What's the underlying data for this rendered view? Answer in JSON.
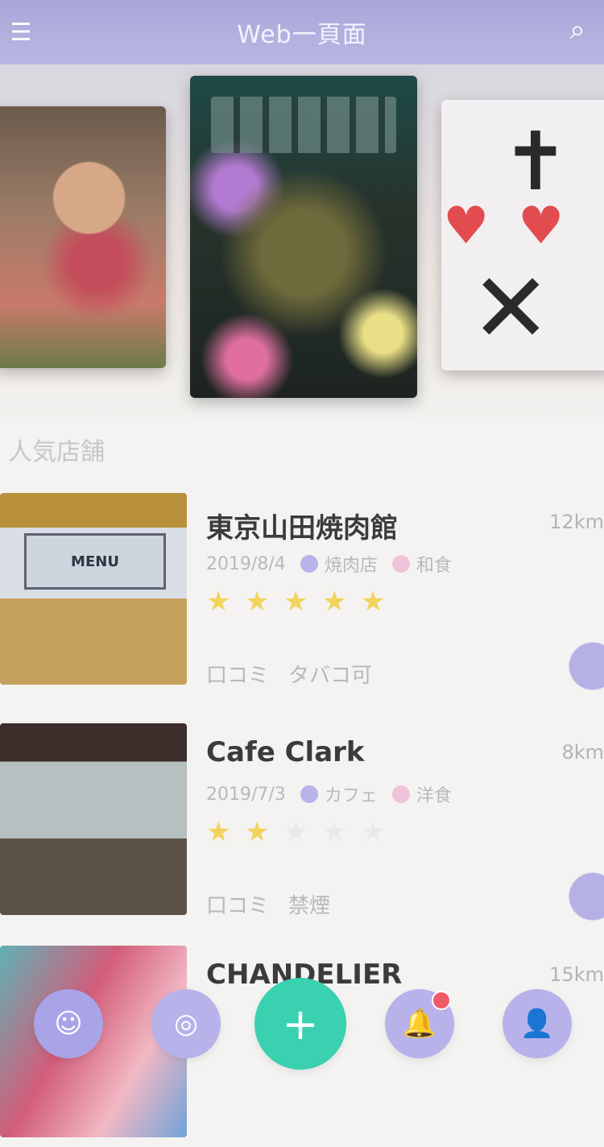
{
  "header": {
    "title": "Web一頁面",
    "menu_icon": "menu-icon",
    "search_icon": "search-icon"
  },
  "section": {
    "label": "人気店舗"
  },
  "items": [
    {
      "name": "東京山田焼肉館",
      "distance": "12km",
      "meta1": "2019/8/4",
      "tag1": "焼肉店",
      "tag2": "和食",
      "rating": 5,
      "foot1": "口コミ",
      "foot2": "タバコ可"
    },
    {
      "name": "Cafe Clark",
      "distance": "8km",
      "meta1": "2019/7/3",
      "tag1": "カフェ",
      "tag2": "洋食",
      "rating": 2,
      "foot1": "口コミ",
      "foot2": "禁煙"
    },
    {
      "name": "CHANDELIER",
      "distance": "15km"
    }
  ],
  "tabbar": {
    "t1_icon": "emoji-icon",
    "t2_icon": "compass-icon",
    "add_label": "+",
    "t4_icon": "bell-icon",
    "t5_icon": "profile-icon"
  },
  "colors": {
    "header": "#b2b0de",
    "accent": "#39d1b0",
    "tab": "#b7b2ea",
    "star": "#f2d35c"
  }
}
